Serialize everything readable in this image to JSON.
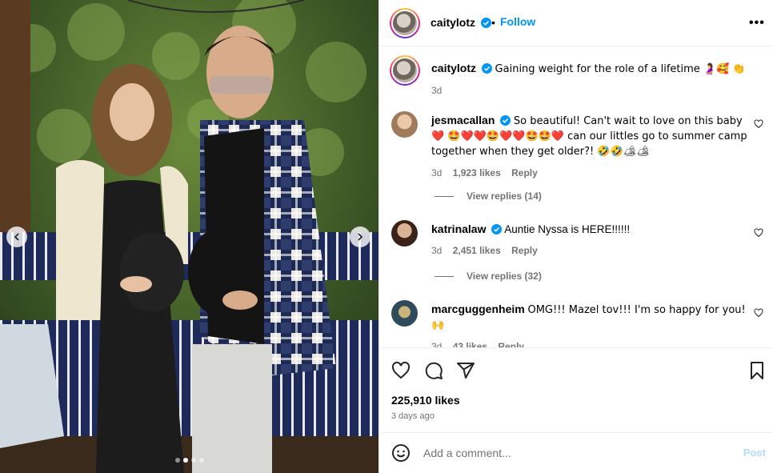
{
  "post": {
    "username": "caitylotz",
    "follow_label": "Follow",
    "more_label": "•••",
    "separator": "•",
    "caption_username": "caitylotz",
    "caption_text": "Gaining weight for the role of a lifetime 🤰🥰 👏",
    "caption_time": "3d"
  },
  "comments": [
    {
      "username": "jesmacallan",
      "verified": true,
      "text": "So beautiful! Can't wait to love on this baby ❤️ 🤩❤️❤️🤩❤️❤️🤩🤩❤️ can our littles go to summer camp together when they get older?! 🤣🤣🏕🏕",
      "time": "3d",
      "likes": "1,923 likes",
      "reply": "Reply",
      "view_replies": "View replies (14)"
    },
    {
      "username": "katrinalaw",
      "verified": true,
      "text": "Auntie Nyssa is HERE!!!!!!",
      "time": "3d",
      "likes": "2,451 likes",
      "reply": "Reply",
      "view_replies": "View replies (32)"
    },
    {
      "username": "marcguggenheim",
      "verified": false,
      "text": "OMG!!! Mazel tov!!! I'm so happy for you! 🙌",
      "time": "3d",
      "likes": "43 likes",
      "reply": "Reply"
    }
  ],
  "stats": {
    "likes": "225,910 likes",
    "posted": "3 days ago"
  },
  "composer": {
    "placeholder": "Add a comment...",
    "post_label": "Post"
  },
  "carousel": {
    "count": 4,
    "active_index": 1
  },
  "colors": {
    "accent": "#0095f6",
    "secondary_text": "#737373",
    "heart_red": "#ed4956",
    "disabled_post": "#b3dbff"
  }
}
